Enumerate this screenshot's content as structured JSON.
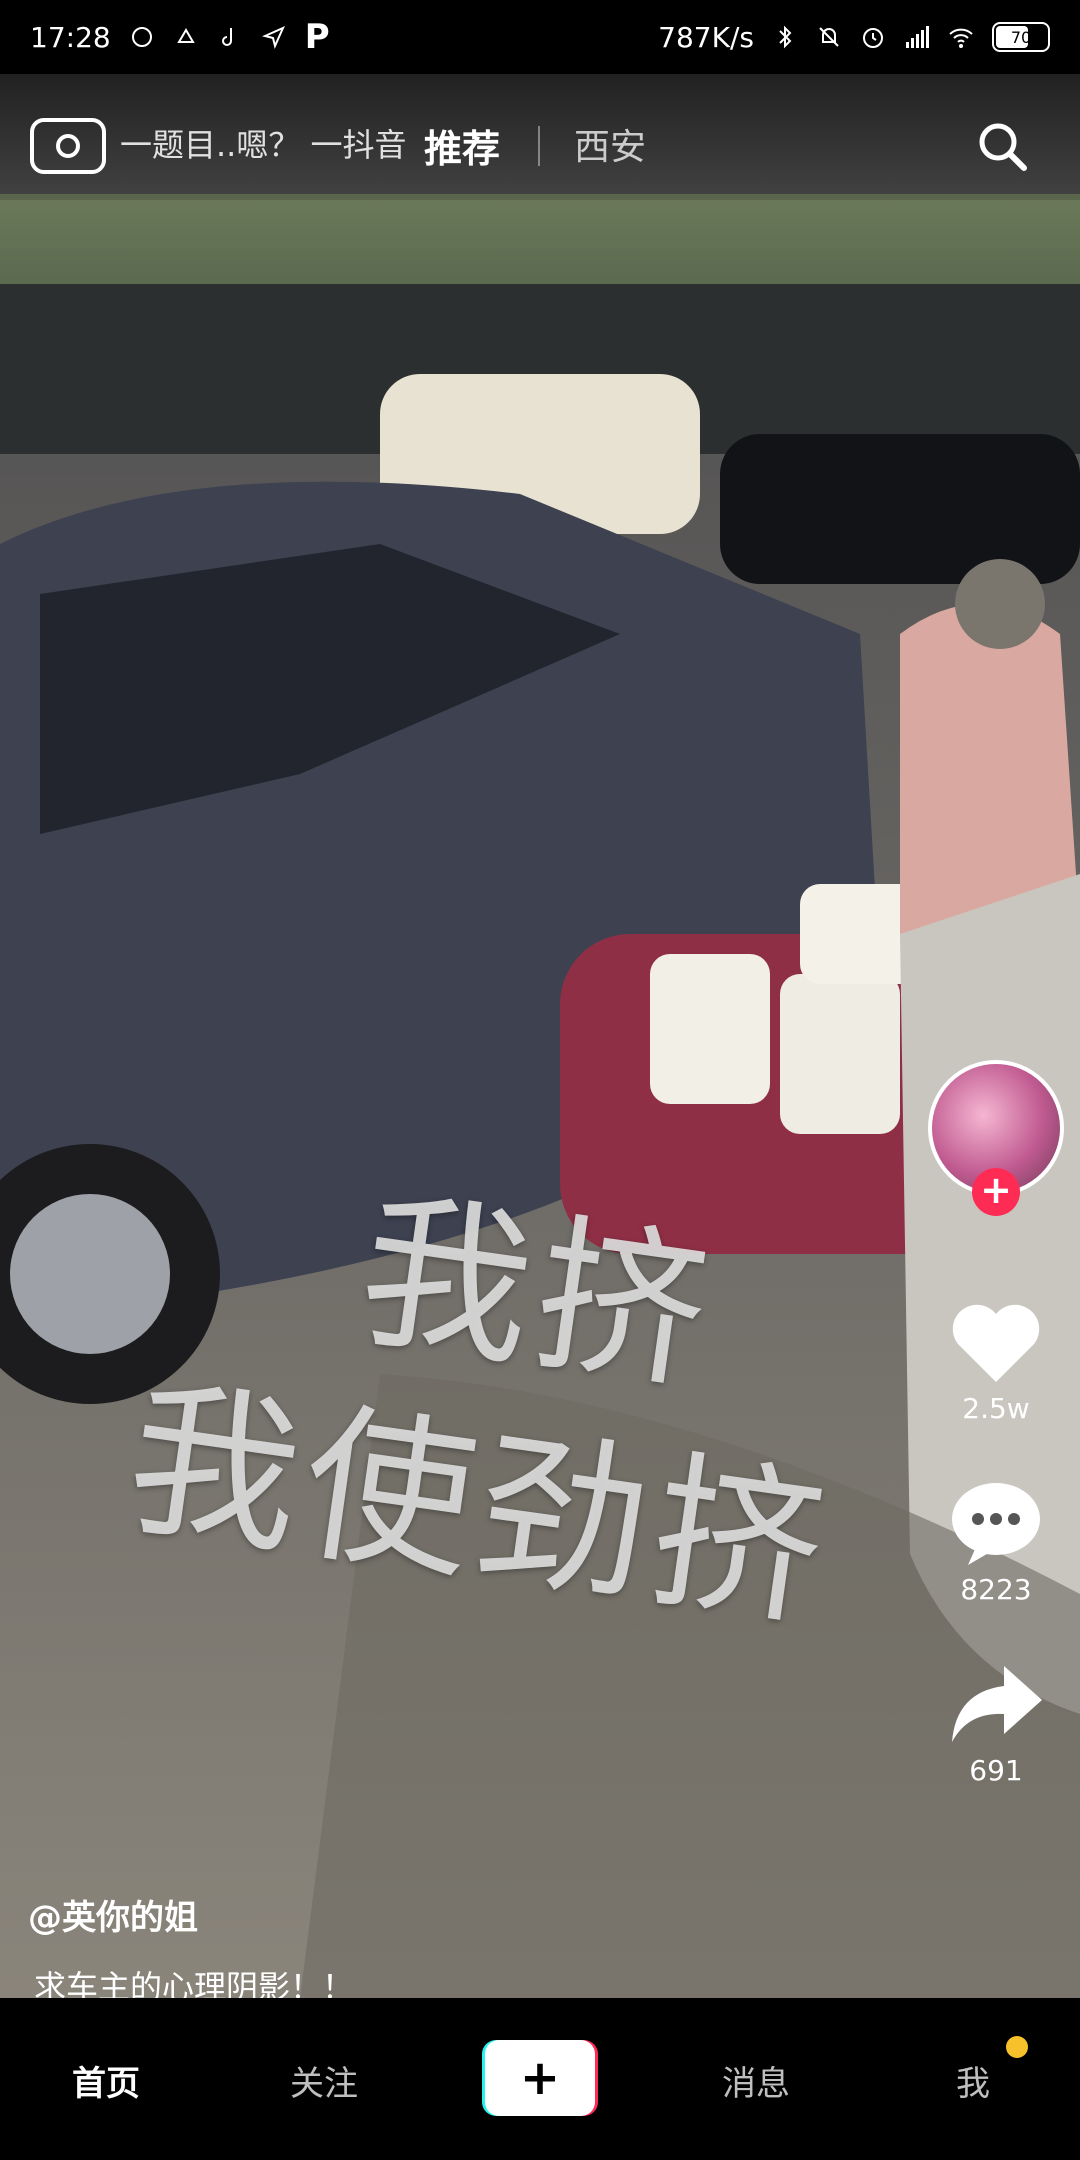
{
  "status_bar": {
    "time": "17:28",
    "network_speed": "787K/s",
    "battery": "70"
  },
  "top_bar": {
    "ticker": "一题目..嗯？ 一抖音",
    "tab_recommend": "推荐",
    "tab_city": "西安"
  },
  "video_overlay": {
    "line1": "我挤",
    "line2": "我使劲挤"
  },
  "actions": {
    "likes": "2.5w",
    "comments": "8223",
    "shares": "691"
  },
  "caption": {
    "username": "@英你的姐",
    "text": "求车主的心理阴影！！"
  },
  "bottom_nav": {
    "home": "首页",
    "follow": "关注",
    "messages": "消息",
    "me": "我",
    "create": "+"
  },
  "colors": {
    "accent_red": "#fe2c55",
    "accent_cyan": "#25f4ee",
    "notice_dot": "#f6c12a"
  }
}
